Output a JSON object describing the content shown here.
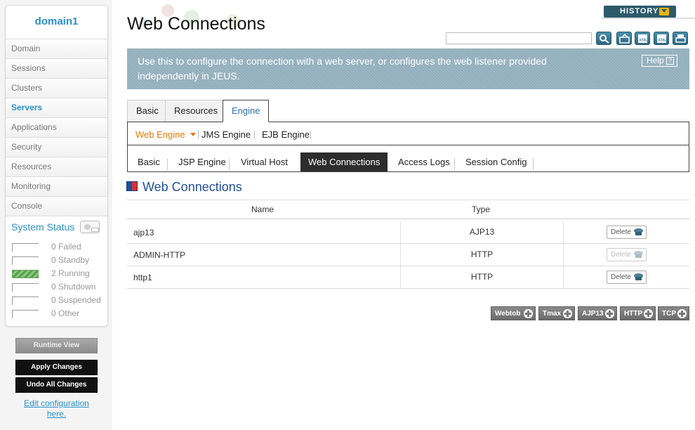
{
  "sidebar": {
    "domain": "domain1",
    "nav": [
      "Domain",
      "Sessions",
      "Clusters",
      "Servers",
      "Applications",
      "Security",
      "Resources",
      "Monitoring",
      "Console"
    ],
    "active_nav": "Servers",
    "system_status": {
      "title": "System Status",
      "rows": [
        {
          "count": "0",
          "label": "Failed"
        },
        {
          "count": "0",
          "label": "Standby"
        },
        {
          "count": "2",
          "label": "Running"
        },
        {
          "count": "0",
          "label": "Shutdown"
        },
        {
          "count": "0",
          "label": "Suspended"
        },
        {
          "count": "0",
          "label": "Other"
        }
      ]
    },
    "runtime_view": "Runtime View",
    "apply_changes": "Apply Changes",
    "undo_changes": "Undo All Changes",
    "edit_config": "Edit configuration here."
  },
  "header": {
    "title": "Web Connections",
    "history": "HISTORY",
    "search_value": ""
  },
  "info": {
    "text": "Use this to configure the connection with a web server, or configures the web listener provided independently in JEUS.",
    "help": "Help",
    "help_q": "?"
  },
  "tabs": [
    "Basic",
    "Resources",
    "Engine"
  ],
  "active_tab": "Engine",
  "subtabs": [
    "Web Engine",
    "JMS Engine",
    "EJB Engine"
  ],
  "active_subtab": "Web Engine",
  "subsubtabs": [
    "Basic",
    "JSP Engine",
    "Virtual Host",
    "Web Connections",
    "Access Logs",
    "Session Config"
  ],
  "active_subsubtab": "Web Connections",
  "section": {
    "title": "Web Connections",
    "columns": [
      "Name",
      "Type"
    ],
    "rows": [
      {
        "name": "ajp13",
        "type": "AJP13",
        "delete": "Delete",
        "delete_enabled": true
      },
      {
        "name": "ADMIN-HTTP",
        "type": "HTTP",
        "delete": "Delete",
        "delete_enabled": false
      },
      {
        "name": "http1",
        "type": "HTTP",
        "delete": "Delete",
        "delete_enabled": true
      }
    ]
  },
  "add_buttons": [
    "Webtob",
    "Tmax",
    "AJP13",
    "HTTP",
    "TCP"
  ],
  "colors": {
    "accent": "#2a8fc7",
    "info_bg": "#93afbd",
    "history_bg": "#2c5a6a",
    "active_subtab": "#e07a00",
    "running": "#59a04f"
  }
}
